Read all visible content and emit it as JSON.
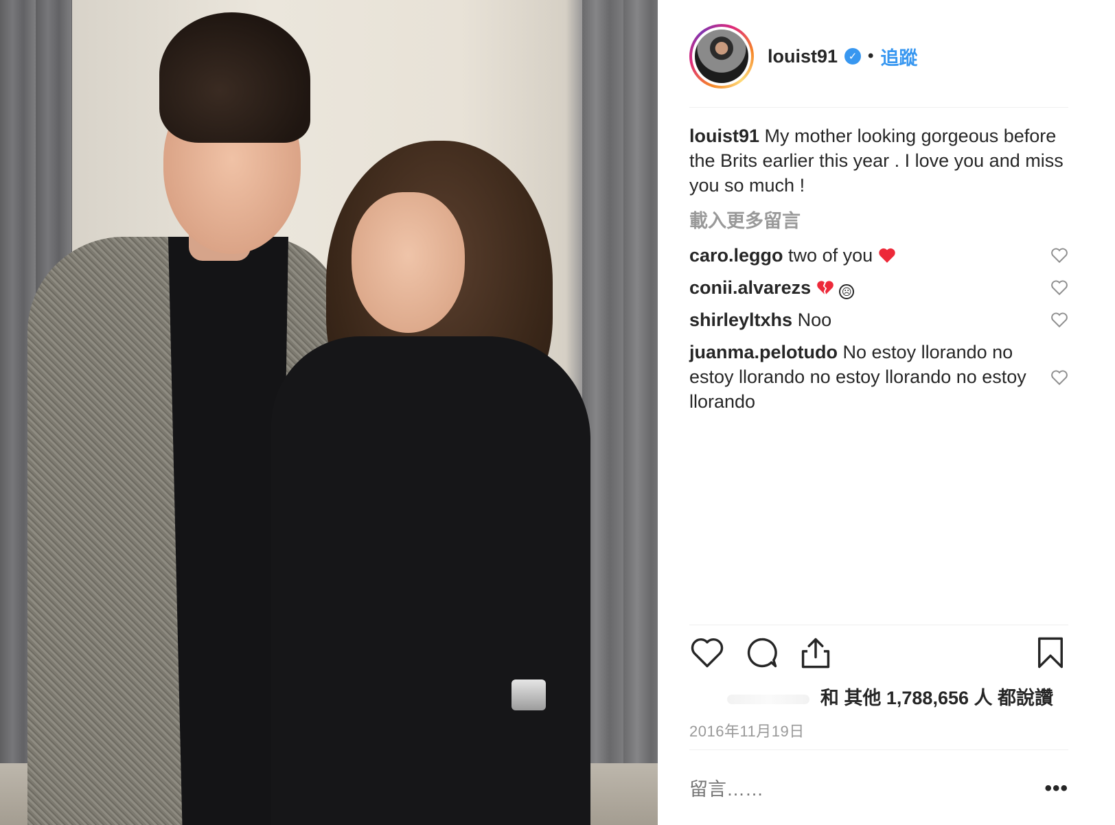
{
  "post": {
    "username": "louist91",
    "follow_label": "追蹤",
    "separator": "•",
    "caption": "My mother looking gorgeous before the Brits earlier this year . I love you and miss you so much !",
    "load_more_label": "載入更多留言",
    "comments": [
      {
        "user": "caro.leggo",
        "text": "two of you",
        "emoji": "heart-emoji"
      },
      {
        "user": "conii.alvarezs",
        "text": "",
        "emoji": "broken-heart-emoji",
        "emoji2": "☹"
      },
      {
        "user": "shirleyltxhs",
        "text": "Noo"
      },
      {
        "user": "juanma.pelotudo",
        "text": "No estoy llorando no estoy llorando no estoy llorando no estoy llorando"
      }
    ],
    "likes_text": "和 其他 1,788,656 人 都說讚",
    "date": "2016年11月19日",
    "comment_placeholder": "留言……",
    "more_label": "•••",
    "verified_mark": "✓"
  },
  "colors": {
    "accent": "#3897f0",
    "text": "#262626",
    "muted": "#999999",
    "heart_red": "#ed4956"
  },
  "icons": [
    "verified-badge-icon",
    "heart-icon",
    "comment-icon",
    "share-icon",
    "bookmark-icon",
    "like-small-icon",
    "more-options-icon"
  ]
}
